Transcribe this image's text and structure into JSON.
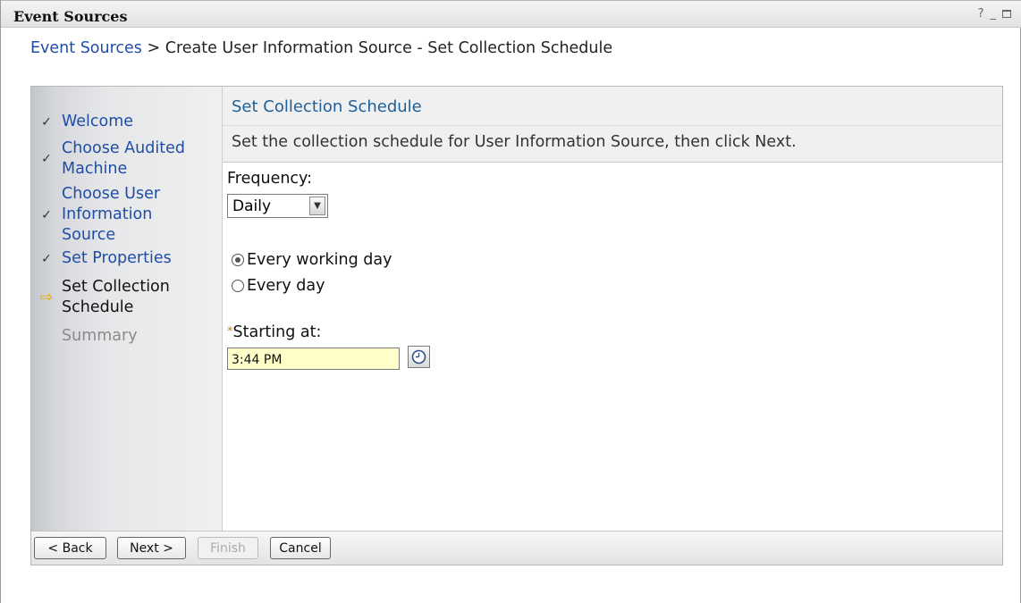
{
  "window": {
    "title": "Event Sources",
    "help_label": "?",
    "minimize_label": "_"
  },
  "breadcrumb": {
    "link": "Event Sources",
    "separator": " > ",
    "current": "Create User Information Source - Set Collection Schedule"
  },
  "steps": [
    {
      "label": "Welcome",
      "state": "done"
    },
    {
      "label": "Choose Audited Machine",
      "state": "done"
    },
    {
      "label": "Choose User Information Source",
      "state": "done"
    },
    {
      "label": "Set Properties",
      "state": "done"
    },
    {
      "label": "Set Collection Schedule",
      "state": "current"
    },
    {
      "label": "Summary",
      "state": "future"
    }
  ],
  "step_marks": {
    "done": "✓",
    "current": "⇨"
  },
  "main": {
    "heading": "Set Collection Schedule",
    "description": "Set the collection schedule for User Information Source, then click Next.",
    "frequency_label": "Frequency:",
    "frequency_value": "Daily",
    "radio_options": [
      {
        "label": "Every working day",
        "checked": true
      },
      {
        "label": "Every day",
        "checked": false
      }
    ],
    "required_marker": "*",
    "starting_at_label": "Starting at:",
    "starting_at_value": "3:44 PM"
  },
  "footer": {
    "back": "< Back",
    "next": "Next >",
    "finish": "Finish",
    "cancel": "Cancel"
  },
  "colors": {
    "link": "#1f4da6",
    "heading": "#1f5f99",
    "input_highlight": "#ffffc9"
  }
}
